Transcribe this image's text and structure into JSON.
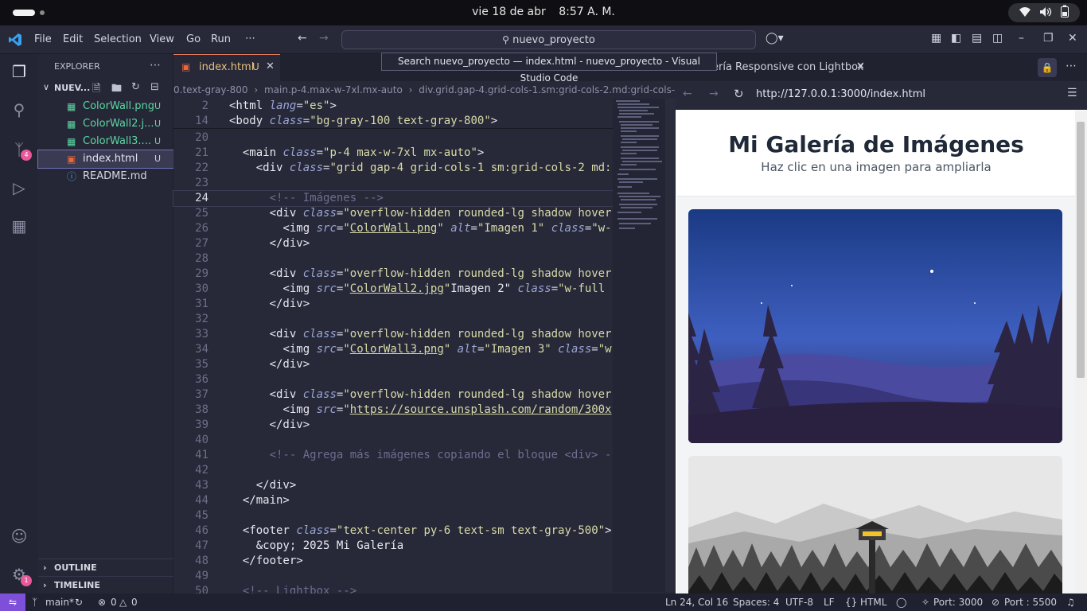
{
  "system": {
    "date": "vie 18 de abr",
    "time": "8:57 A. M."
  },
  "titlebar": {
    "menu": [
      "File",
      "Edit",
      "Selection",
      "View",
      "Go",
      "Run",
      "⋯"
    ],
    "search_text": "nuevo_proyecto"
  },
  "tooltip": "Search nuevo_proyecto — index.html - nuevo_proyecto - Visual Studio Code",
  "sidebar": {
    "title": "EXPLORER",
    "folder": "NUEV...",
    "files": [
      {
        "name": "ColorWall.png",
        "status": "U"
      },
      {
        "name": "ColorWall2.j...",
        "status": "U"
      },
      {
        "name": "ColorWall3....",
        "status": "U"
      },
      {
        "name": "index.html",
        "status": "U"
      },
      {
        "name": "README.md",
        "status": ""
      }
    ],
    "outline": "OUTLINE",
    "timeline": "TIMELINE"
  },
  "activity": {
    "source_control_badge": "4",
    "settings_badge": "1"
  },
  "editor": {
    "tab_label": "index.html",
    "tab_status": "U",
    "breadcrumb": [
      "0.text-gray-800",
      "main.p-4.max-w-7xl.mx-auto",
      "div.grid.gap-4.grid-cols-1.sm:grid-cols-2.md:grid-cols-"
    ],
    "lines": [
      {
        "n": "2",
        "t": "<html lang=\"es\">"
      },
      {
        "n": "14",
        "t": "<body class=\"bg-gray-100 text-gray-800\">"
      },
      {
        "n": "20",
        "t": ""
      },
      {
        "n": "21",
        "t": "  <main class=\"p-4 max-w-7xl mx-auto\">"
      },
      {
        "n": "22",
        "t": "    <div class=\"grid gap-4 grid-cols-1 sm:grid-cols-2 md:"
      },
      {
        "n": "23",
        "t": ""
      },
      {
        "n": "24",
        "t": "      <!-- Imágenes -->"
      },
      {
        "n": "25",
        "t": "      <div class=\"overflow-hidden rounded-lg shadow hover"
      },
      {
        "n": "26",
        "t": "        <img src=\"ColorWall.png\" alt=\"Imagen 1\" class=\"w-"
      },
      {
        "n": "27",
        "t": "      </div>"
      },
      {
        "n": "28",
        "t": ""
      },
      {
        "n": "29",
        "t": "      <div class=\"overflow-hidden rounded-lg shadow hover"
      },
      {
        "n": "30",
        "t": "        <img src=\"ColorWall2.jpg\"Imagen 2\" class=\"w-full"
      },
      {
        "n": "31",
        "t": "      </div>"
      },
      {
        "n": "32",
        "t": ""
      },
      {
        "n": "33",
        "t": "      <div class=\"overflow-hidden rounded-lg shadow hover"
      },
      {
        "n": "34",
        "t": "        <img src=\"ColorWall3.png\" alt=\"Imagen 3\" class=\"w"
      },
      {
        "n": "35",
        "t": "      </div>"
      },
      {
        "n": "36",
        "t": ""
      },
      {
        "n": "37",
        "t": "      <div class=\"overflow-hidden rounded-lg shadow hover"
      },
      {
        "n": "38",
        "t": "        <img src=\"https://source.unsplash.com/random/300x"
      },
      {
        "n": "39",
        "t": "      </div>"
      },
      {
        "n": "40",
        "t": ""
      },
      {
        "n": "41",
        "t": "      <!-- Agrega más imágenes copiando el bloque <div> -"
      },
      {
        "n": "42",
        "t": ""
      },
      {
        "n": "43",
        "t": "    </div>"
      },
      {
        "n": "44",
        "t": "  </main>"
      },
      {
        "n": "45",
        "t": ""
      },
      {
        "n": "46",
        "t": "  <footer class=\"text-center py-6 text-sm text-gray-500\">"
      },
      {
        "n": "47",
        "t": "    &copy; 2025 Mi Galería"
      },
      {
        "n": "48",
        "t": "  </footer>"
      },
      {
        "n": "49",
        "t": ""
      },
      {
        "n": "50",
        "t": "  <!-- Lightbox -->"
      }
    ],
    "current_line": "24"
  },
  "browser": {
    "tab_title": "ería Responsive con Lightbox",
    "url": "http://127.0.0.1:3000/index.html",
    "page_title": "Mi Galería de Imágenes",
    "page_subtitle": "Haz clic en una imagen para ampliarla"
  },
  "status": {
    "branch": "main*",
    "problems_errors": "0",
    "problems_warnings": "0",
    "position": "Ln 24, Col 16",
    "spaces": "Spaces: 4",
    "encoding": "UTF-8",
    "eol": "LF",
    "language": "HTML",
    "port1": "Port: 3000",
    "port2": "Port : 5500"
  },
  "colors": {
    "accent": "#7e4fd8",
    "badge": "#e8589b",
    "untracked": "#5bd6a3"
  }
}
